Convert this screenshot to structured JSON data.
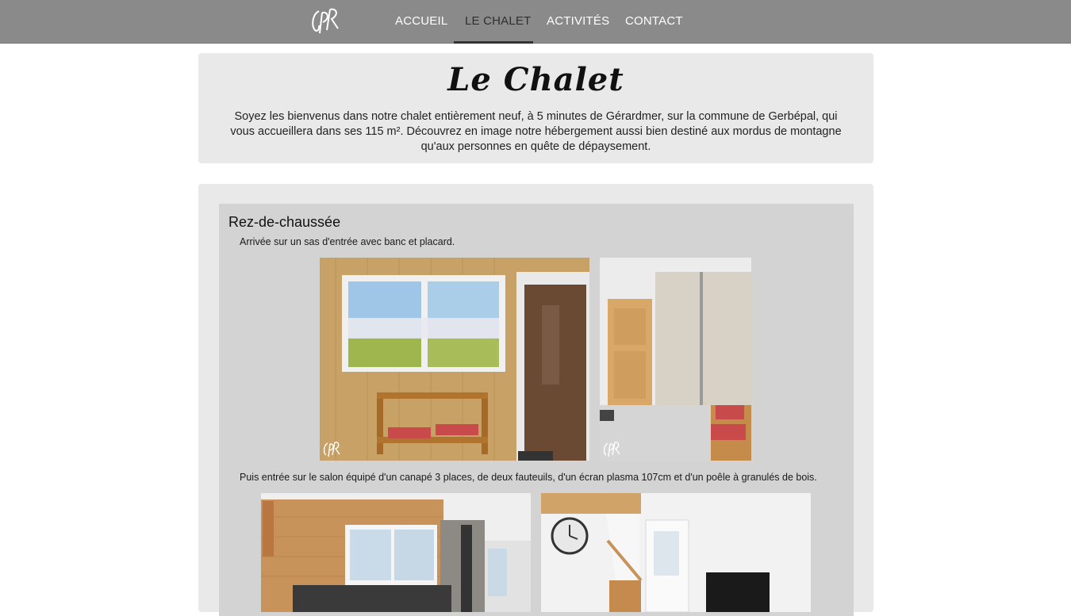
{
  "nav": {
    "items": [
      {
        "label": "ACCUEIL"
      },
      {
        "label": "LE CHALET"
      },
      {
        "label": "ACTIVITÉS"
      },
      {
        "label": "CONTACT"
      }
    ]
  },
  "intro": {
    "title": "Le Chalet",
    "text": "Soyez les bienvenus dans notre chalet entièrement neuf, à 5 minutes de Gérardmer, sur la commune de Gerbépal, qui vous accueillera dans ses 115 m². Découvrez en image notre hébergement aussi bien destiné aux mordus de montagne qu'aux personnes en quête de dépaysement."
  },
  "section": {
    "title": "Rez-de-chaussée",
    "caption_1": "Arrivée sur un sas d'entrée avec banc et placard.",
    "caption_2": "Puis entrée sur le salon équipé d'un canapé 3 places, de deux fauteuils, d'un écran plasma 107cm et d'un poêle à granulés de bois."
  },
  "colors": {
    "nav_bg": "#8a8a8a",
    "panel_bg": "#e9e9e9",
    "section_bg": "#d3d3d3",
    "wood": "#c9a46a"
  }
}
